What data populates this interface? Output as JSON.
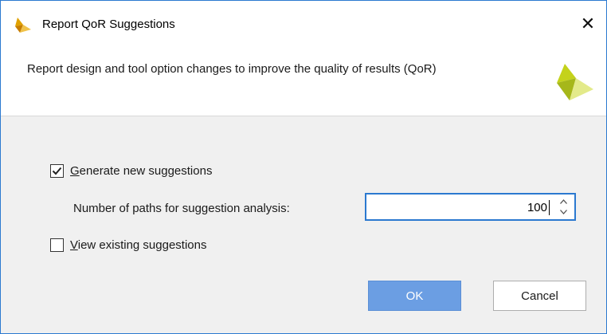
{
  "window": {
    "title": "Report QoR Suggestions",
    "icon": "vivado-logo-icon",
    "close_glyph": "✕"
  },
  "banner": {
    "description": "Report design and tool option changes to improve the quality of results (QoR)",
    "logo_icon": "vivado-logo-icon"
  },
  "options": {
    "generate": {
      "label_first": "G",
      "label_rest": "enerate new suggestions",
      "checked": true
    },
    "paths": {
      "label": "Number of paths for suggestion analysis:",
      "value": "100"
    },
    "view": {
      "label_first": "V",
      "label_rest": "iew existing suggestions",
      "checked": false
    }
  },
  "buttons": {
    "ok": "OK",
    "cancel": "Cancel"
  },
  "colors": {
    "accent": "#2b79d0",
    "ok_button": "#6b9ee3",
    "logo_dark": "#a6b71a",
    "logo_mid": "#c4d21b",
    "logo_light": "#e3ea8a"
  }
}
